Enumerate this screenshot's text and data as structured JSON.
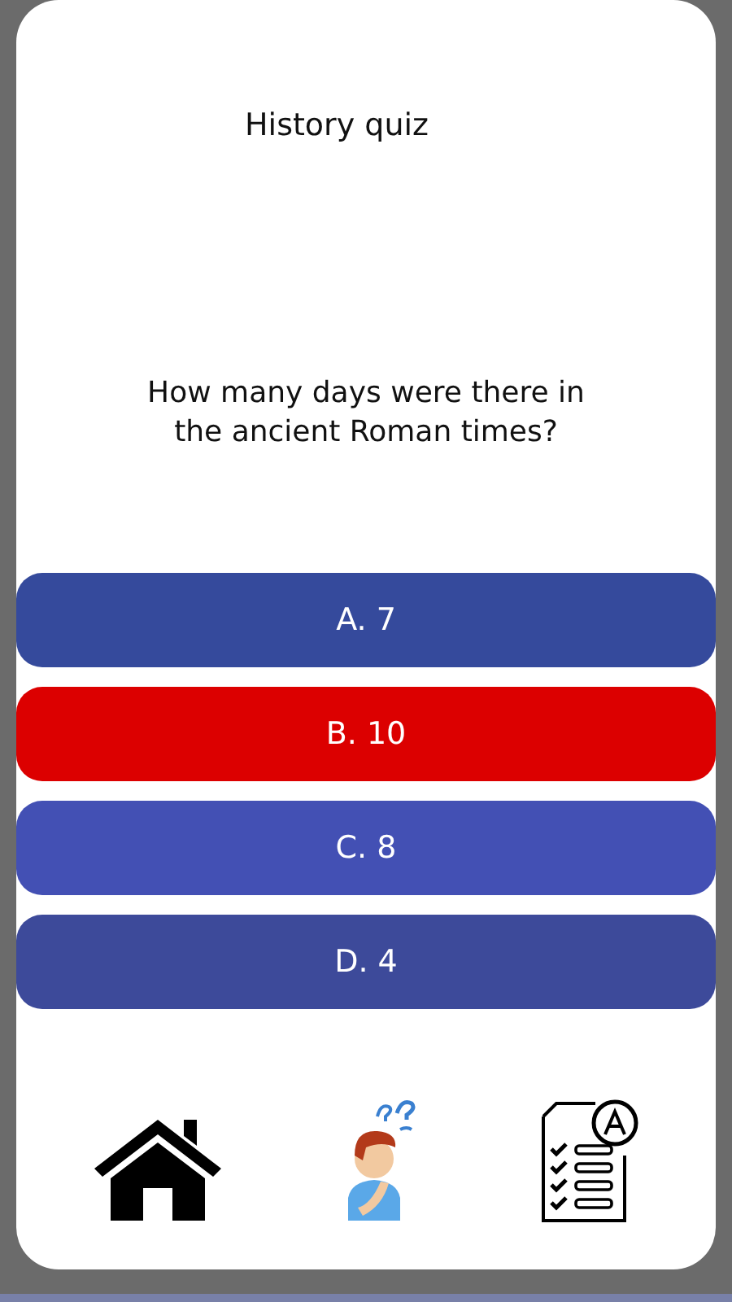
{
  "title": "History quiz",
  "question": "How many days were there in the ancient Roman times?",
  "answers": [
    {
      "label": "A. 7",
      "color": "#354a9c"
    },
    {
      "label": "B. 10",
      "color": "#dc0000"
    },
    {
      "label": "C. 8",
      "color": "#4350b4"
    },
    {
      "label": "D. 4",
      "color": "#3d4a9a"
    }
  ]
}
